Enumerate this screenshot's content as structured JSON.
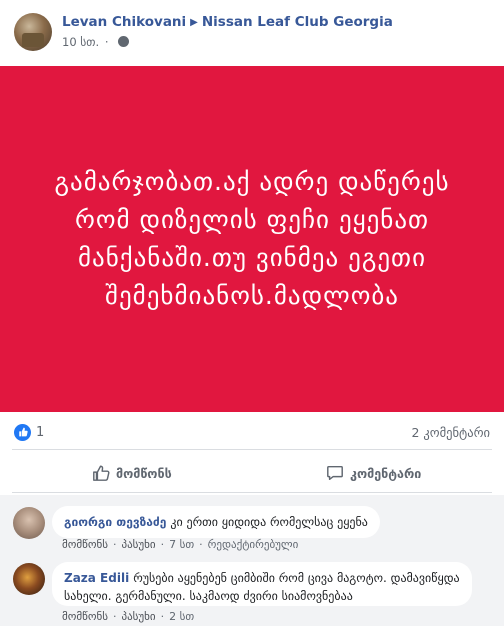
{
  "post": {
    "author": "Levan Chikovani",
    "group": "Nissan Leaf Club Georgia",
    "time": "10 სთ.",
    "body_text": "გამარჯობათ.აქ ადრე დაწერეს რომ დიზელის ფეჩი ეყენათ მანქანაში.თუ ვინმეა ეგეთი შემეხმიანოს.მადლობა",
    "banner_color": "#e1173f"
  },
  "reactions": {
    "like_count": "1",
    "comments_label": "2 კომენტარი"
  },
  "actions": {
    "like_label": "მომწონს",
    "comment_label": "კომენტარი"
  },
  "comments": [
    {
      "author": "გიორგი თევზაძე",
      "text": "კი ერთი ყიდიდა რომელსაც ეყენა",
      "like_label": "მომწონს",
      "reply_label": "პასუხი",
      "time": "7 სთ",
      "edited_label": "რედაქტირებული"
    },
    {
      "author": "Zaza Edili",
      "text": "რუსები აყენებენ ციმბიში რომ ცივა მაგოტო. დამავიწყდა სახელი. გერმანული. საკმაოდ ძვირი სიამოვნებაა",
      "like_label": "მომწონს",
      "reply_label": "პასუხი",
      "time": "2 სთ"
    }
  ],
  "colors": {
    "link": "#385898",
    "like_blue": "#2078f4",
    "secondary_text": "#606770"
  },
  "icons": [
    "globe-icon",
    "caret-right-icon",
    "like-icon",
    "thumbs-up-icon",
    "comment-icon",
    "more-icon"
  ]
}
